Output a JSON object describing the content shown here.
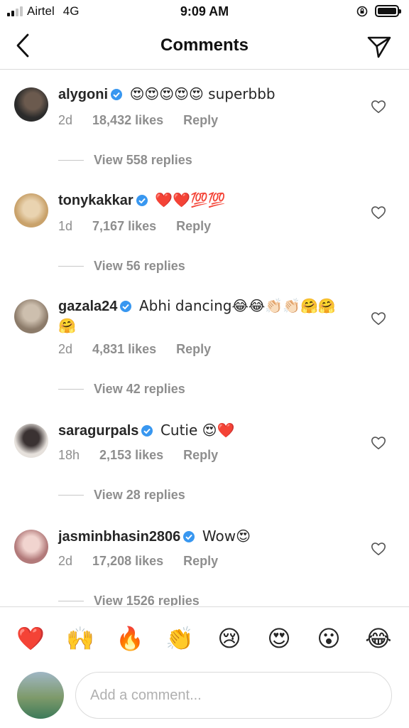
{
  "status_bar": {
    "carrier": "Airtel",
    "network": "4G",
    "time": "9:09 AM"
  },
  "header": {
    "title": "Comments"
  },
  "comments": [
    {
      "username": "alygoni",
      "text": "😍😍😍😍😍 superbbb",
      "time": "2d",
      "likes": "18,432 likes",
      "reply": "Reply",
      "view_replies": "View 558 replies",
      "avatar_colors": [
        "#2b2b2b",
        "#6b5a4e"
      ]
    },
    {
      "username": "tonykakkar",
      "text": "❤️❤️💯💯",
      "time": "1d",
      "likes": "7,167 likes",
      "reply": "Reply",
      "view_replies": "View 56 replies",
      "avatar_colors": [
        "#c9a26b",
        "#e9d3b0"
      ]
    },
    {
      "username": "gazala24",
      "text": "Abhi dancing😂😂👏🏻👏🏻🤗🤗🤗",
      "time": "2d",
      "likes": "4,831 likes",
      "reply": "Reply",
      "view_replies": "View 42 replies",
      "avatar_colors": [
        "#8c7b6a",
        "#cdbfae"
      ]
    },
    {
      "username": "saragurpals",
      "text": "Cutie 😍❤️",
      "time": "18h",
      "likes": "2,153 likes",
      "reply": "Reply",
      "view_replies": "View 28 replies",
      "avatar_colors": [
        "#3a3232",
        "#e6e1dc"
      ]
    },
    {
      "username": "jasminbhasin2806",
      "text": "Wow😍",
      "time": "2d",
      "likes": "17,208 likes",
      "reply": "Reply",
      "view_replies": "View 1526 replies",
      "avatar_colors": [
        "#b27a7a",
        "#f1d4cf"
      ]
    }
  ],
  "emoji_bar": [
    "❤️",
    "🙌",
    "🔥",
    "👏",
    "😢",
    "😍",
    "😮",
    "😂"
  ],
  "composer": {
    "placeholder": "Add a comment..."
  },
  "colors": {
    "verified": "#3897f0",
    "secondary_text": "#8e8e8e",
    "divider": "#dbdbdb"
  }
}
